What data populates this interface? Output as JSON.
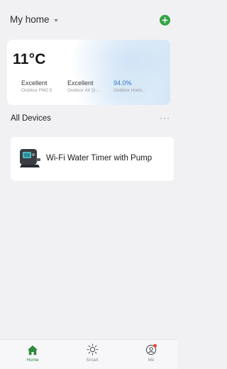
{
  "header": {
    "home_name": "My home",
    "add_icon": "plus-circle-icon",
    "accent_color": "#33a445"
  },
  "weather": {
    "temperature": "11°C",
    "metrics": [
      {
        "value": "Excellent",
        "label": "Outdoor PM2.5"
      },
      {
        "value": "Excellent",
        "label": "Outdoor Air Q..."
      },
      {
        "value": "94.0%",
        "label": "Outdoor Humi..."
      }
    ]
  },
  "devices": {
    "section_title": "All Devices",
    "more_label": "···",
    "items": [
      {
        "name": "Wi-Fi Water Timer with Pump",
        "icon": "water-timer-device-icon"
      }
    ]
  },
  "tabbar": {
    "tabs": [
      {
        "label": "Home",
        "icon": "home-icon",
        "active": true
      },
      {
        "label": "Smart",
        "icon": "sun-icon",
        "active": false
      },
      {
        "label": "Me",
        "icon": "user-icon",
        "active": false,
        "badge": true
      }
    ],
    "active_color": "#2f8a3c"
  }
}
